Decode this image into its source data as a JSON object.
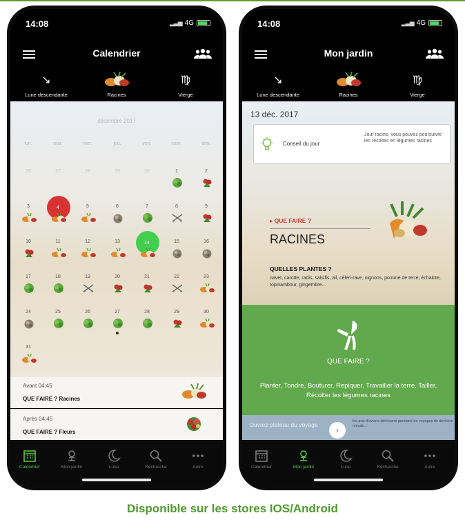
{
  "colors": {
    "accent_green": "#4f9a2f",
    "red_day": "#d93232",
    "green_day": "#42cf4f",
    "tab_active": "#56c93b",
    "green_panel": "#62a84c"
  },
  "left_phone": {
    "status_time": "14:08",
    "network": "4G",
    "title": "Calendrier",
    "moon_bar": [
      {
        "label": "Lune descendante",
        "icon": "descending-moon-icon"
      },
      {
        "label": "Racines",
        "icon": "root-vegetables-icon"
      },
      {
        "label": "Vierge",
        "icon": "virgo-icon"
      }
    ],
    "month": "décembre 2017",
    "weekdays": [
      "lun.",
      "mar.",
      "mer.",
      "jeu.",
      "ven.",
      "sam.",
      "dim."
    ],
    "days": [
      {
        "n": "26",
        "faded": true
      },
      {
        "n": "27",
        "faded": true
      },
      {
        "n": "28",
        "faded": true
      },
      {
        "n": "29",
        "faded": true
      },
      {
        "n": "30",
        "faded": true
      },
      {
        "n": "1",
        "icon": "leaf"
      },
      {
        "n": "2",
        "icon": "flower"
      },
      {
        "n": "3",
        "icon": "root"
      },
      {
        "n": "4",
        "icon": "root",
        "mark": "red"
      },
      {
        "n": "5",
        "icon": "root"
      },
      {
        "n": "6",
        "icon": "fruit"
      },
      {
        "n": "7",
        "icon": "leaf"
      },
      {
        "n": "8",
        "icon": "none"
      },
      {
        "n": "9",
        "icon": "flower"
      },
      {
        "n": "10",
        "icon": "flower"
      },
      {
        "n": "11",
        "icon": "root"
      },
      {
        "n": "12",
        "icon": "root"
      },
      {
        "n": "13",
        "icon": "root"
      },
      {
        "n": "14",
        "icon": "root",
        "mark": "green"
      },
      {
        "n": "15",
        "icon": "fruit"
      },
      {
        "n": "16",
        "icon": "fruit"
      },
      {
        "n": "17",
        "icon": "leaf"
      },
      {
        "n": "18",
        "icon": "leaf"
      },
      {
        "n": "19",
        "icon": "none"
      },
      {
        "n": "20",
        "icon": "flower"
      },
      {
        "n": "21",
        "icon": "flower"
      },
      {
        "n": "22",
        "icon": "none"
      },
      {
        "n": "23",
        "icon": "root"
      },
      {
        "n": "24",
        "icon": "fruit"
      },
      {
        "n": "25",
        "icon": "leaf"
      },
      {
        "n": "26",
        "icon": "leaf"
      },
      {
        "n": "27",
        "icon": "leaf",
        "dot": true
      },
      {
        "n": "28",
        "icon": "leaf"
      },
      {
        "n": "29",
        "icon": "flower"
      },
      {
        "n": "30",
        "icon": "root"
      },
      {
        "n": "31",
        "icon": "root"
      }
    ],
    "cards": [
      {
        "time": "Avant 04:45",
        "label": "QUE FAIRE ? Racines",
        "icon": "root"
      },
      {
        "time": "Après 04:45",
        "label": "QUE FAIRE ? Fleurs",
        "icon": "flower"
      }
    ],
    "tabs": [
      {
        "label": "Calendrier",
        "icon": "calendar-icon",
        "active": true
      },
      {
        "label": "Mon jardin",
        "icon": "garden-icon",
        "active": false
      },
      {
        "label": "Lune",
        "icon": "moon-icon",
        "active": false
      },
      {
        "label": "Recherche",
        "icon": "search-icon",
        "active": false
      },
      {
        "label": "Autre",
        "icon": "more-icon",
        "active": false
      }
    ]
  },
  "right_phone": {
    "status_time": "14:08",
    "network": "4G",
    "title": "Mon jardin",
    "moon_bar": [
      {
        "label": "Lune descendante",
        "icon": "descending-moon-icon"
      },
      {
        "label": "Racines",
        "icon": "root-vegetables-icon"
      },
      {
        "label": "Vierge",
        "icon": "virgo-icon"
      }
    ],
    "date": "13 déc. 2017",
    "tip": {
      "title": "Conseil du jour",
      "text": "Jour racine, vous pouvez poursuivre les récoltes en légumes racines"
    },
    "que_faire_label": "▸ QUE FAIRE ?",
    "racines_title": "RACINES",
    "plants_heading": "QUELLES PLANTES ?",
    "plants_text": "navet, carotte, radis, salsifis, ail, céleri-rave, oignons, pomme de terre, échalote, topinambour, gingembre...",
    "green_title": "QUE FAIRE ?",
    "green_text": "Planter, Tondre, Bouturer, Repiquer, Travailler la terre, Tailler, Récolter les légumes racines",
    "ad": {
      "left": "Ouvrez plateau du voyage",
      "button": "›",
      "right": "les prix d'avions diminuent pendant les voyages de dernière minute..."
    },
    "tabs": [
      {
        "label": "Calendrier",
        "icon": "calendar-icon",
        "active": false
      },
      {
        "label": "Mon jardin",
        "icon": "garden-icon",
        "active": true
      },
      {
        "label": "Lune",
        "icon": "moon-icon",
        "active": false
      },
      {
        "label": "Recherche",
        "icon": "search-icon",
        "active": false
      },
      {
        "label": "Autre",
        "icon": "more-icon",
        "active": false
      }
    ]
  },
  "caption": "Disponible sur les stores IOS/Android"
}
